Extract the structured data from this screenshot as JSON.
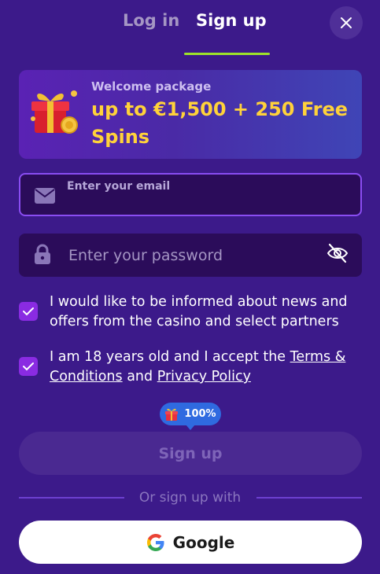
{
  "tabs": {
    "login": "Log in",
    "signup": "Sign up",
    "active": "signup"
  },
  "banner": {
    "label": "Welcome package",
    "title": "up to €1,500 + 250 Free Spins"
  },
  "email": {
    "placeholder": "Enter your email",
    "value": ""
  },
  "password": {
    "placeholder": "Enter your password",
    "value": ""
  },
  "checkboxes": {
    "news": {
      "checked": true,
      "text": "I would like to be informed about news and offers from the casino and select partners"
    },
    "terms": {
      "checked": true,
      "prefix": "I am 18 years old and I accept the ",
      "terms_link": "Terms & Conditions",
      "middle": " and ",
      "privacy_link": "Privacy Policy"
    }
  },
  "badge": {
    "value": "100%",
    "icon": "gift-icon"
  },
  "signup_button": "Sign up",
  "divider_text": "Or sign up with",
  "google_button": "Google",
  "colors": {
    "background": "#3c1a8a",
    "accent_underline": "#9ee22a",
    "banner_title": "#ffd23a",
    "checkbox": "#8a2be2",
    "badge": "#2f6ae0"
  }
}
